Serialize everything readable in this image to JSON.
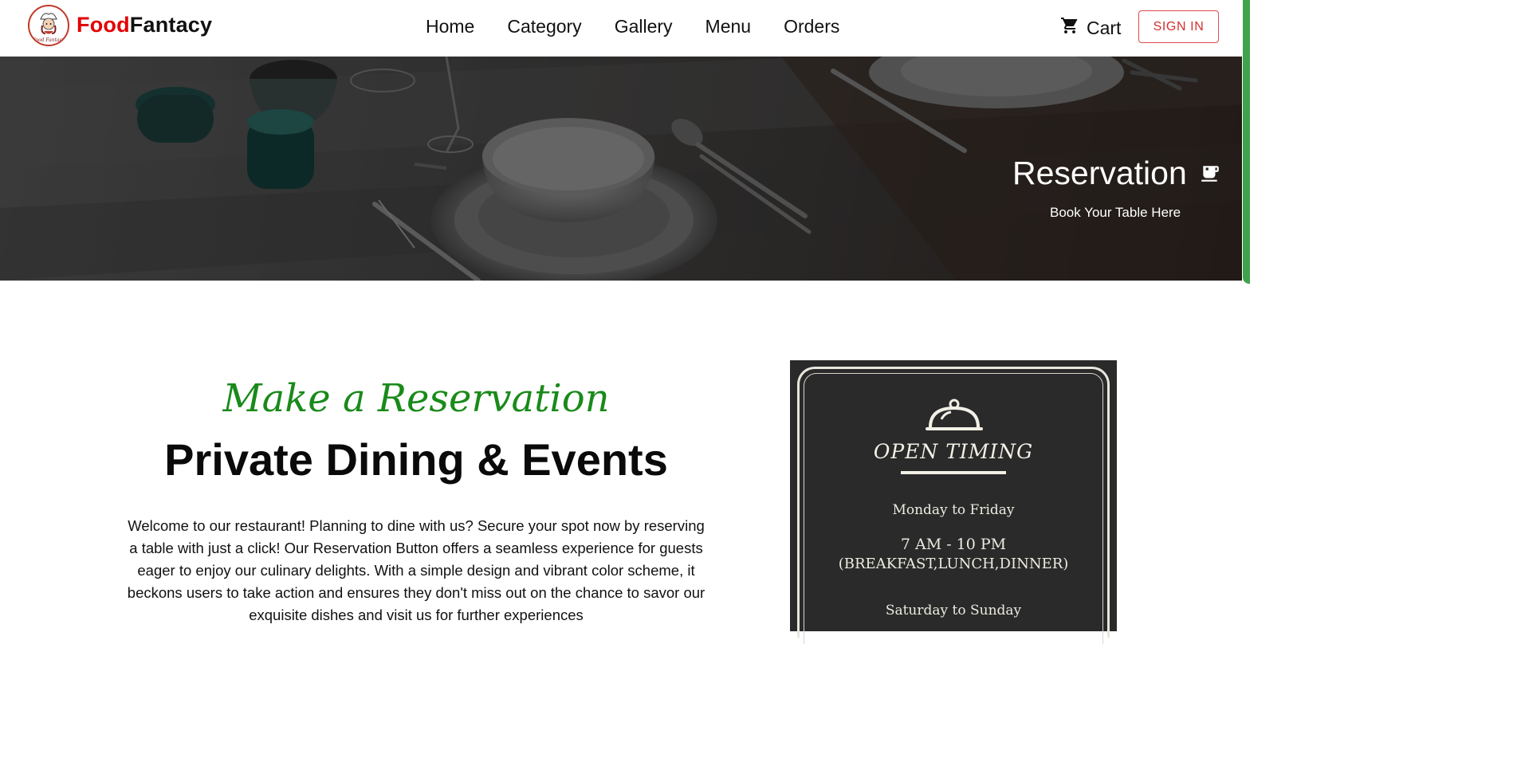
{
  "brand": {
    "part1": "Food",
    "part2": "Fantacy",
    "logo_text": "Food Fantacy"
  },
  "nav": {
    "links": [
      "Home",
      "Category",
      "Gallery",
      "Menu",
      "Orders"
    ],
    "cart_label": "Cart",
    "signin_label": "SIGN IN"
  },
  "hero": {
    "title": "Reservation",
    "subtitle": "Book Your Table Here"
  },
  "main": {
    "script_title": "Make a Reservation",
    "heading": "Private Dining & Events",
    "body": "Welcome to our restaurant! Planning to dine with us? Secure your spot now by reserving a table with just a click! Our Reservation Button offers a seamless experience for guests eager to enjoy our culinary delights. With a simple design and vibrant color scheme, it beckons users to take action and ensures they don't miss out on the chance to savor our exquisite dishes and visit us for further experiences"
  },
  "timing_card": {
    "heading": "OPEN TIMING",
    "weekday_label": "Monday to Friday",
    "weekday_hours": "7 AM - 10 PM",
    "weekday_meals": "(BREAKFAST,LUNCH,DINNER)",
    "weekend_label": "Saturday to Sunday"
  },
  "colors": {
    "brand_red": "#e30000",
    "script_green": "#1a8a1a",
    "signin_red": "#d32f2f",
    "scroll_green": "#3fa34d",
    "card_bg": "#2a2a2a"
  }
}
